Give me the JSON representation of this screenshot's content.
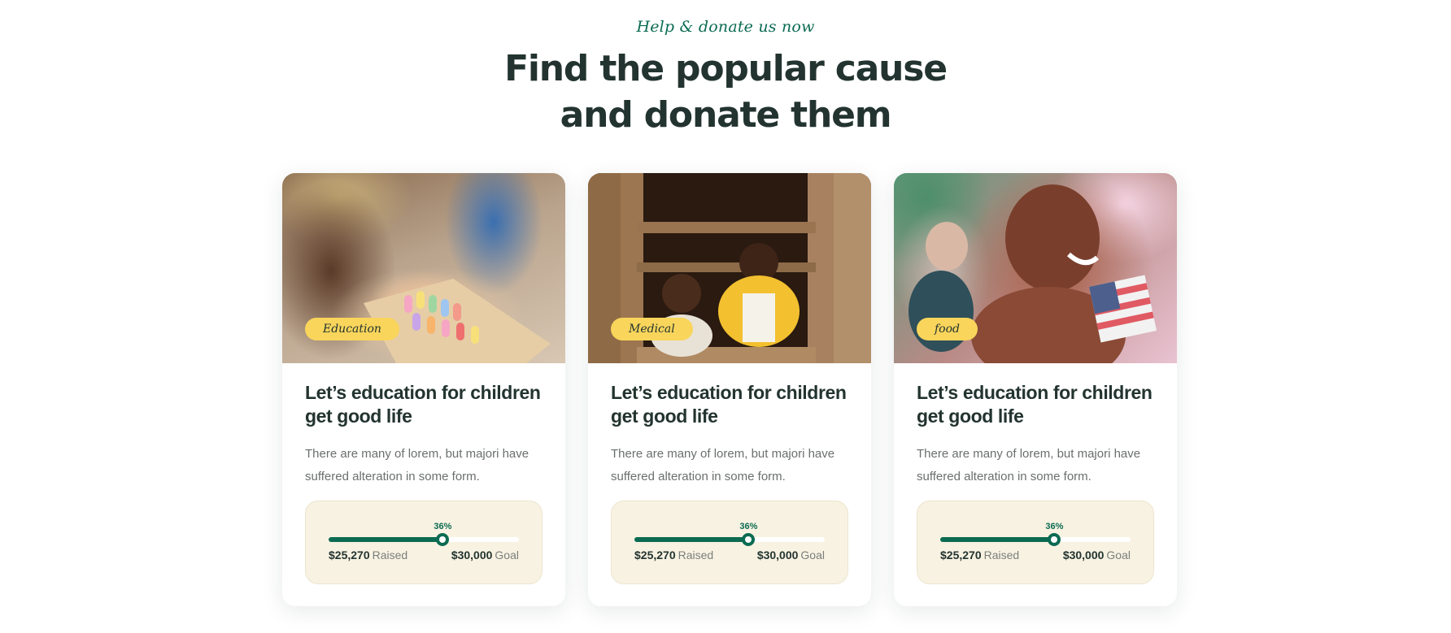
{
  "header": {
    "tagline": "Help & donate us now",
    "title_line1": "Find the popular cause",
    "title_line2": "and donate them"
  },
  "causes": [
    {
      "category": "Education",
      "title": "Let’s education for children get good life",
      "description": "There are many of lorem, but majori have suffered alteration in some form.",
      "percent_label": "36%",
      "progress": 0.6,
      "raised_amount": "$25,270",
      "raised_label": "Raised",
      "goal_amount": "$30,000",
      "goal_label": "Goal"
    },
    {
      "category": "Medical",
      "title": "Let’s education for children get good life",
      "description": "There are many of lorem, but majori have suffered alteration in some form.",
      "percent_label": "36%",
      "progress": 0.6,
      "raised_amount": "$25,270",
      "raised_label": "Raised",
      "goal_amount": "$30,000",
      "goal_label": "Goal"
    },
    {
      "category": "food",
      "title": "Let’s education for children get good life",
      "description": "There are many of lorem, but majori have suffered alteration in some form.",
      "percent_label": "36%",
      "progress": 0.6,
      "raised_amount": "$25,270",
      "raised_label": "Raised",
      "goal_amount": "$30,000",
      "goal_label": "Goal"
    }
  ],
  "colors": {
    "brand_green": "#0b6b52",
    "badge_yellow": "#f9d55b",
    "heading": "#233430",
    "progress_bg": "#f8f2e2"
  }
}
